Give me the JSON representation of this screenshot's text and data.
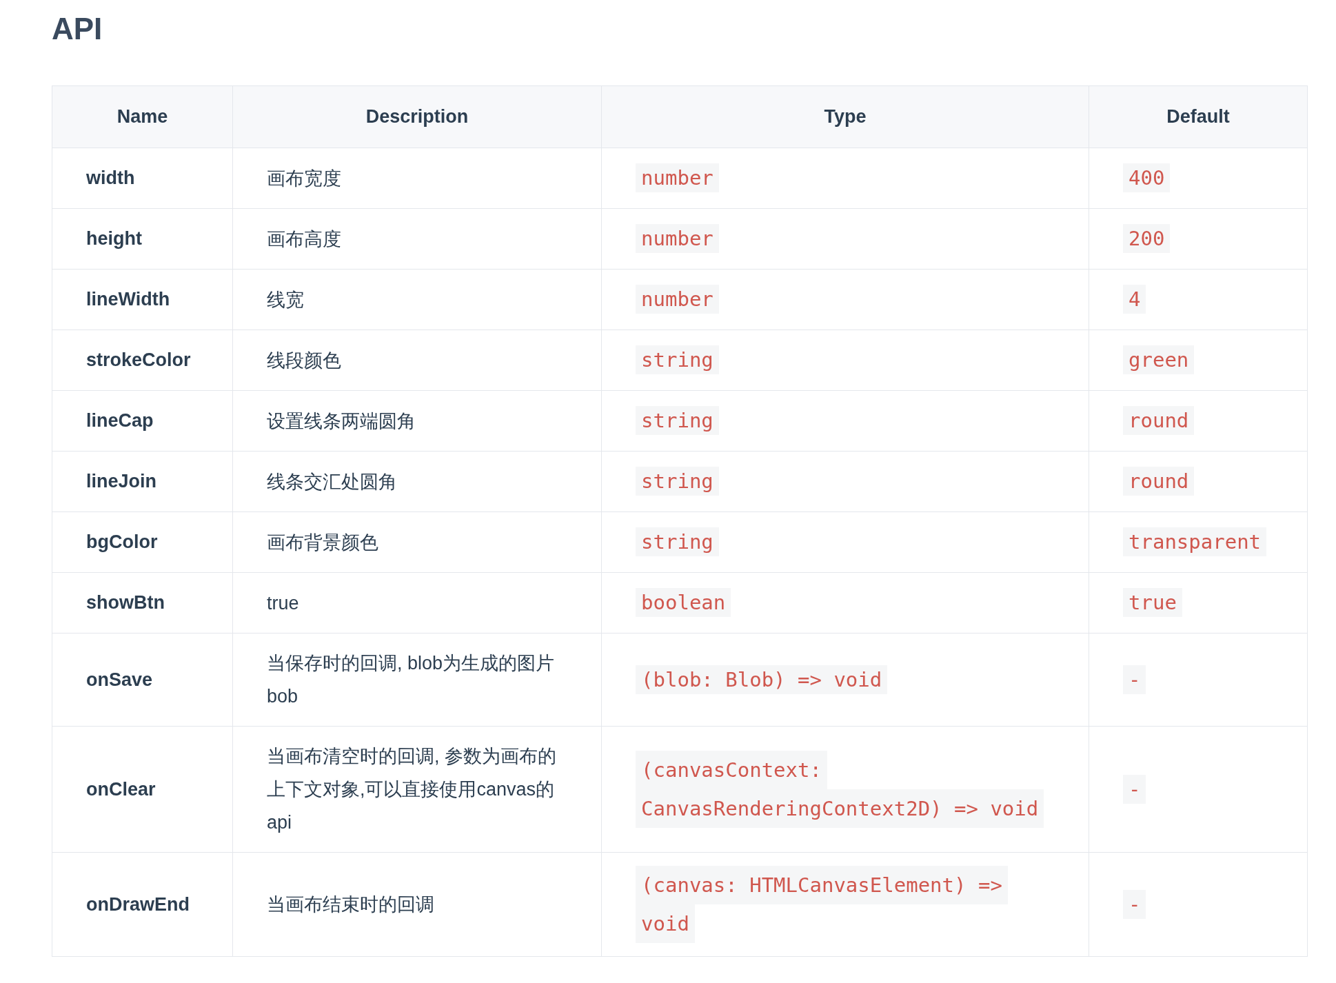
{
  "title": "API",
  "table": {
    "columns": [
      "Name",
      "Description",
      "Type",
      "Default"
    ],
    "rows": [
      {
        "name": "width",
        "description": "画布宽度",
        "type": "number",
        "default": "400"
      },
      {
        "name": "height",
        "description": "画布高度",
        "type": "number",
        "default": "200"
      },
      {
        "name": "lineWidth",
        "description": "线宽",
        "type": "number",
        "default": "4"
      },
      {
        "name": "strokeColor",
        "description": "线段颜色",
        "type": "string",
        "default": "green"
      },
      {
        "name": "lineCap",
        "description": "设置线条两端圆角",
        "type": "string",
        "default": "round"
      },
      {
        "name": "lineJoin",
        "description": "线条交汇处圆角",
        "type": "string",
        "default": "round"
      },
      {
        "name": "bgColor",
        "description": "画布背景颜色",
        "type": "string",
        "default": "transparent"
      },
      {
        "name": "showBtn",
        "description": "true",
        "type": "boolean",
        "default": "true"
      },
      {
        "name": "onSave",
        "description": "当保存时的回调, blob为生成的图片bob",
        "type": "(blob: Blob) => void",
        "default": "-"
      },
      {
        "name": "onClear",
        "description": "当画布清空时的回调, 参数为画布的上下文对象,可以直接使用canvas的api",
        "type": [
          "(canvasContext:",
          "CanvasRenderingContext2D) => void"
        ],
        "default": "-"
      },
      {
        "name": "onDrawEnd",
        "description": "当画布结束时的回调",
        "type": [
          "(canvas: HTMLCanvasElement) =>",
          "void"
        ],
        "default": "-"
      }
    ]
  }
}
